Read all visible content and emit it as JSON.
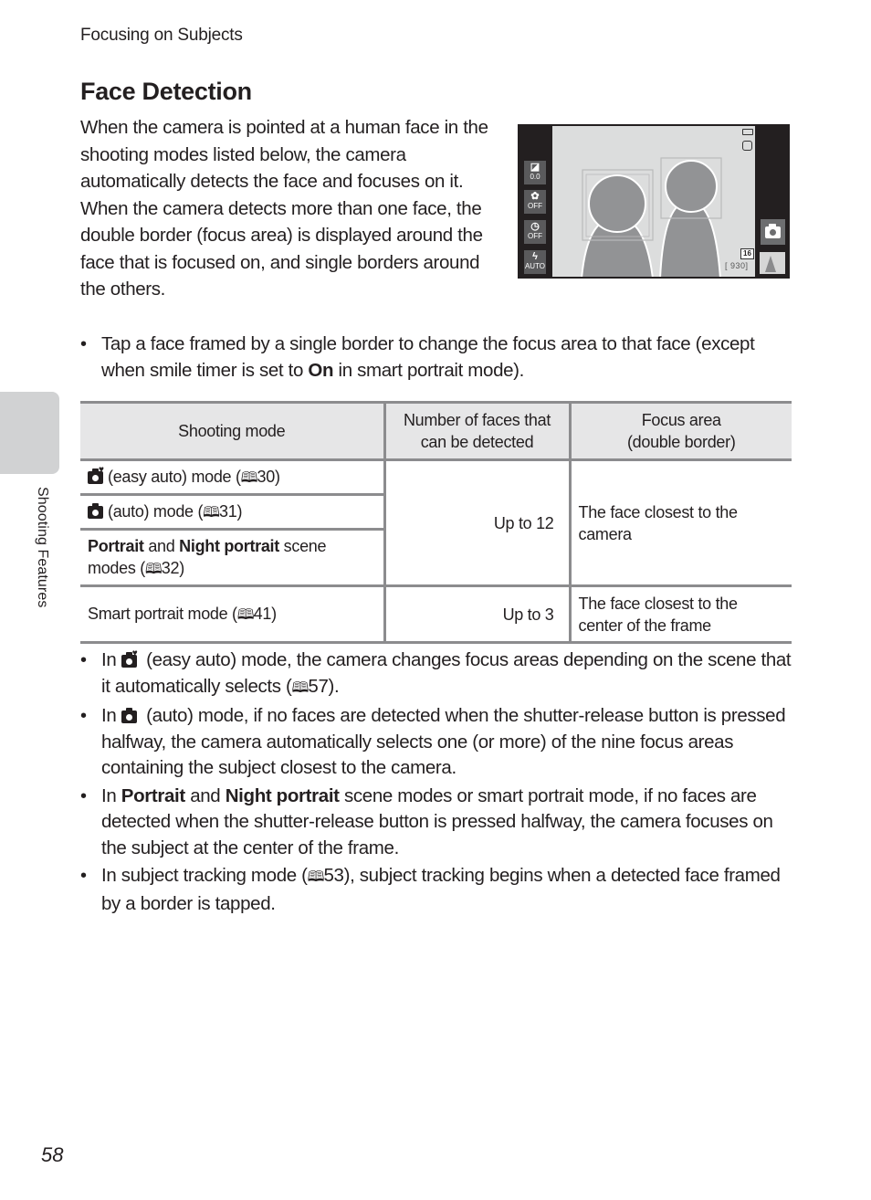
{
  "header": {
    "running_head": "Focusing on Subjects",
    "title": "Face Detection"
  },
  "intro": {
    "paragraphs": [
      "When the camera is pointed at a human face in the shooting modes listed below, the camera automatically detects the face and focuses on it.",
      "When the camera detects more than one face, the double border (focus area) is displayed around the face that is focused on, and single borders around the others."
    ]
  },
  "camera_screen": {
    "left_buttons": [
      {
        "icon": "exposure-compensation-icon",
        "glyph": "◪",
        "label": "0.0"
      },
      {
        "icon": "macro-mode-icon",
        "glyph": "✿",
        "label": "OFF"
      },
      {
        "icon": "self-timer-icon",
        "glyph": "◷",
        "label": "OFF"
      },
      {
        "icon": "flash-mode-icon",
        "glyph": "ϟ",
        "label": "AUTO"
      }
    ],
    "vr_label": "◉",
    "image_size": "16M",
    "image_size_display": "16",
    "exposures_remaining": "[ 930]"
  },
  "tap_note": {
    "prefix": "Tap a face framed by a single border to change the focus area to that face (except when smile timer is set to ",
    "bold": "On",
    "suffix": " in smart portrait mode)."
  },
  "table": {
    "headers": [
      "Shooting mode",
      "Number of faces that can be detected",
      "Focus area (double border)"
    ],
    "header_lines": {
      "col2": [
        "Number of faces that",
        "can be detected"
      ],
      "col3": [
        "Focus area",
        "(double border)"
      ]
    },
    "rows": [
      {
        "mode_icon": "easy-auto-mode-icon",
        "mode": "(easy auto) mode (",
        "page": "30",
        "close": ")"
      },
      {
        "mode_icon": "auto-mode-icon",
        "mode": "(auto) mode (",
        "page": "31",
        "close": ")"
      },
      {
        "bold1": "Portrait",
        "mid": " and ",
        "bold2": "Night portrait",
        "mode": " scene modes (",
        "page": "32",
        "close": ")"
      },
      {
        "mode": "Smart portrait mode (",
        "page": "41",
        "close": ")"
      }
    ],
    "group1_faces": "Up to 12",
    "group1_focus": "The face closest to the camera",
    "group2_faces": "Up to 3",
    "group2_focus": "The face closest to the center of the frame"
  },
  "notes": [
    {
      "prefix": "In ",
      "icon": "easy-auto-mode-icon",
      "text": " (easy auto) mode, the camera changes focus areas depending on the scene that it automatically selects (",
      "page": "57",
      "suffix": ")."
    },
    {
      "prefix": "In ",
      "icon": "auto-mode-icon",
      "text": " (auto) mode, if no faces are detected when the shutter-release button is pressed halfway, the camera automatically selects one (or more) of the nine focus areas containing the subject closest to the camera."
    },
    {
      "prefix": "In ",
      "bold1": "Portrait",
      "mid": " and ",
      "bold2": "Night portrait",
      "text": " scene modes or smart portrait mode, if no faces are detected when the shutter-release button is pressed halfway, the camera focuses on the subject at the center of the frame."
    },
    {
      "prefix": "In subject tracking mode (",
      "page": "53",
      "text": "), subject tracking begins when a detected face framed by a border is tapped."
    }
  ],
  "book_glyph": "🕮",
  "bullet": "•",
  "side_tab": {
    "label": "Shooting Features"
  },
  "page_number": "58"
}
